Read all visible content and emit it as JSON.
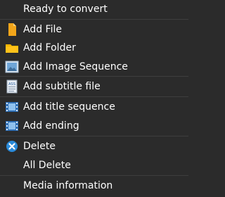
{
  "menu": {
    "header": "Ready to convert",
    "items": [
      {
        "label": "Add File",
        "icon": "file-icon"
      },
      {
        "label": "Add Folder",
        "icon": "folder-icon"
      },
      {
        "label": "Add Image Sequence",
        "icon": "image-sequence-icon"
      },
      {
        "label": "Add subtitle file",
        "icon": "subtitle-file-icon"
      },
      {
        "label": "Add title sequence",
        "icon": "film-strip-icon"
      },
      {
        "label": "Add ending",
        "icon": "film-strip-icon"
      },
      {
        "label": "Delete",
        "icon": "delete-icon"
      },
      {
        "label": "All Delete"
      },
      {
        "label": "Media information"
      }
    ]
  },
  "colors": {
    "background": "#2b2b2b",
    "text": "#ffffff",
    "separator": "#3e3e3e",
    "file_orange": "#f2a51a",
    "folder_yellow": "#f0b400",
    "delete_blue": "#2a8ad8"
  }
}
